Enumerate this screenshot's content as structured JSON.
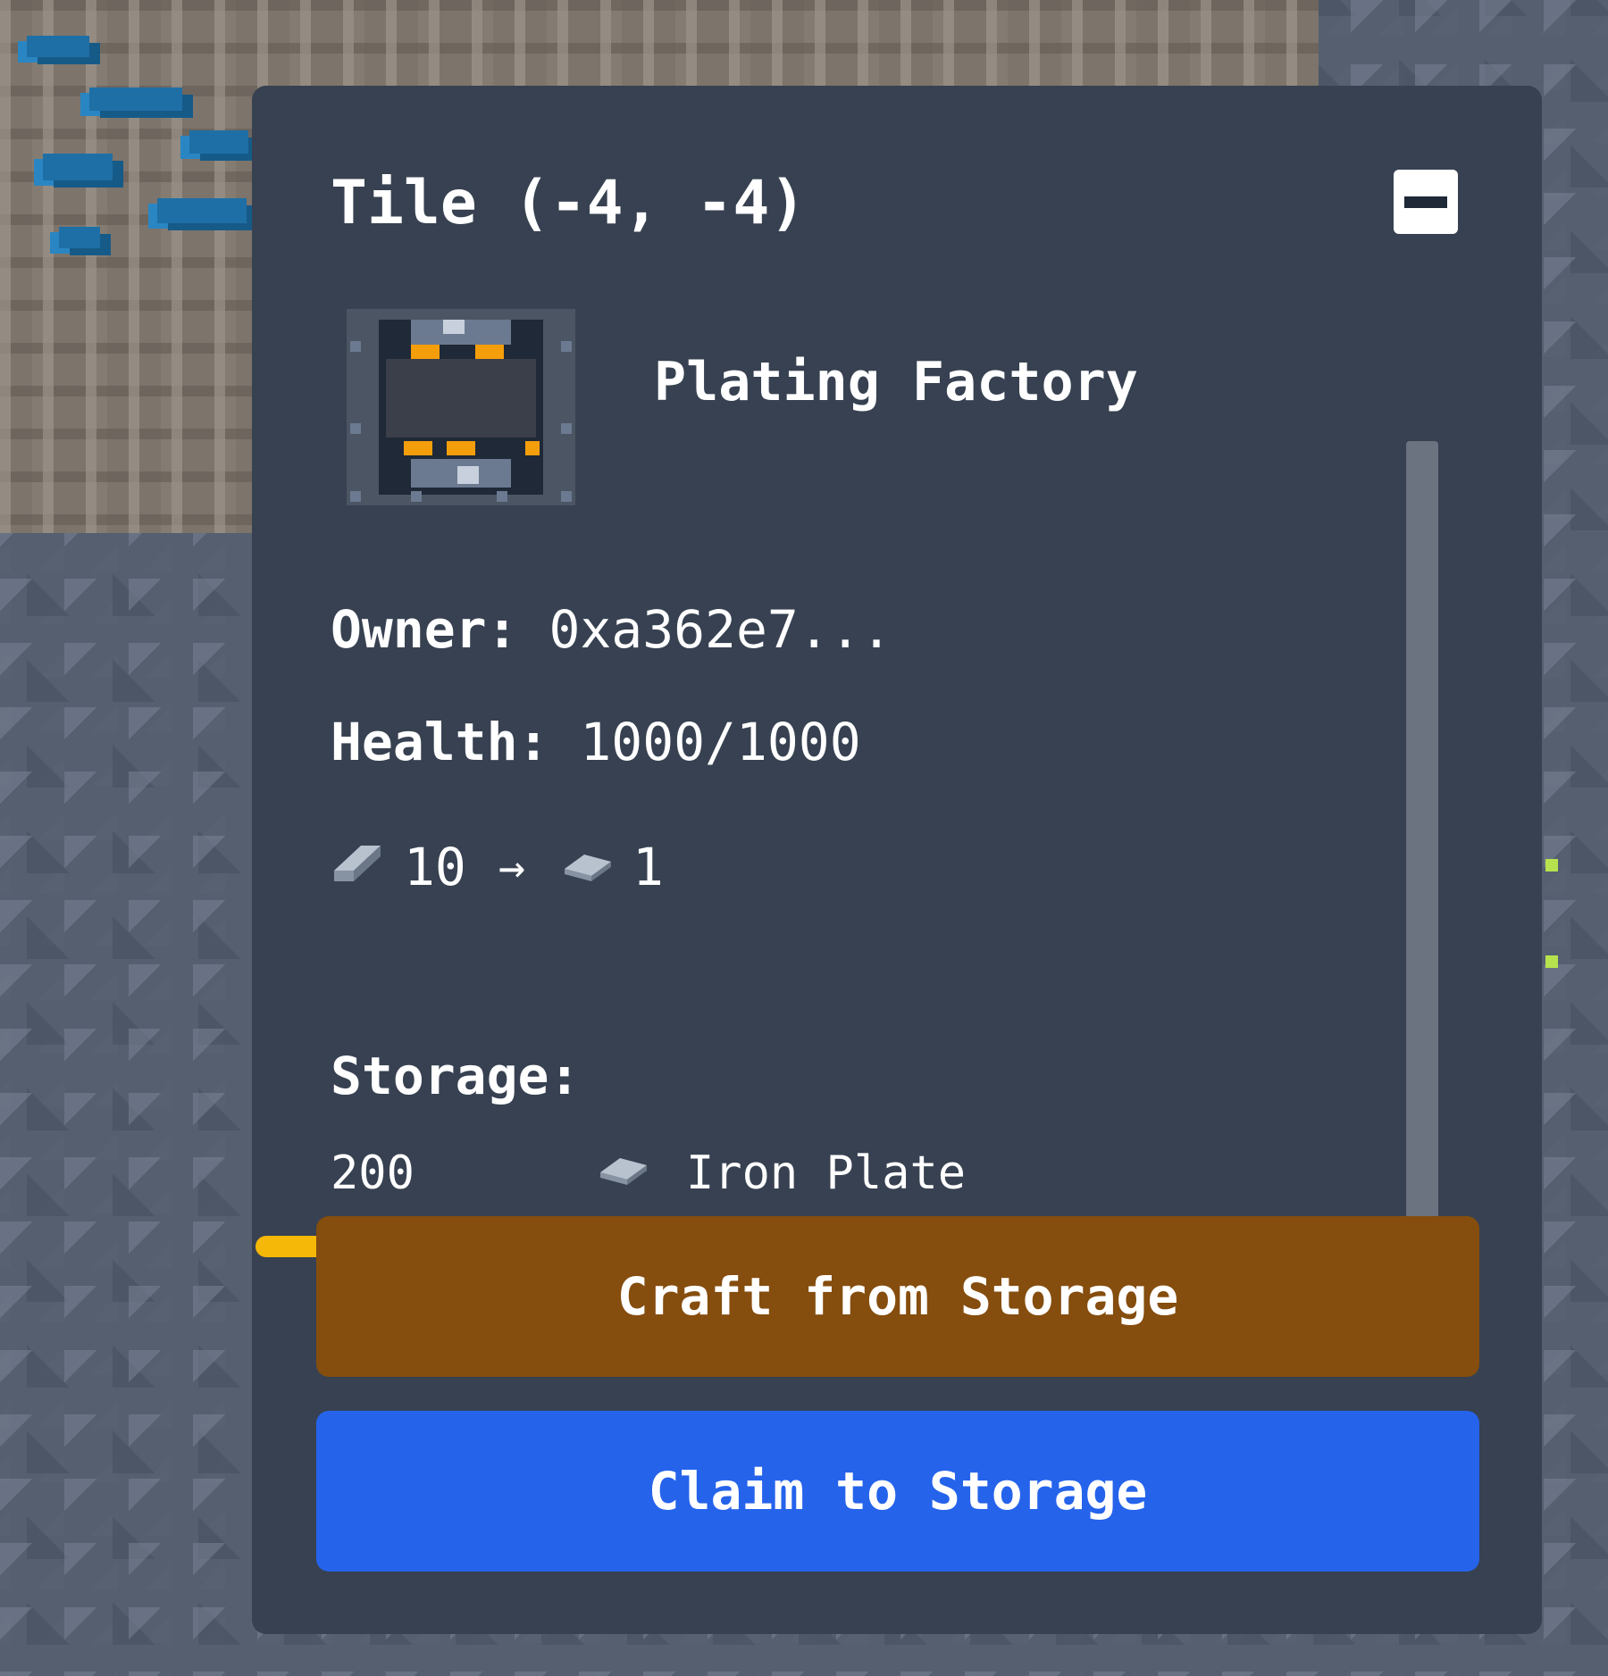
{
  "tile": {
    "title": "Tile (-4, -4)"
  },
  "building": {
    "name": "Plating Factory",
    "icon": "plating-factory-icon"
  },
  "owner": {
    "label": "Owner:",
    "value": "0xa362e7..."
  },
  "health": {
    "label": "Health:",
    "value": "1000/1000"
  },
  "recipe": {
    "input_icon": "iron-ingot-icon",
    "input_amount": "10",
    "arrow": "→",
    "output_icon": "iron-plate-icon",
    "output_amount": "1"
  },
  "storage": {
    "label": "Storage:",
    "items": [
      {
        "quantity": "200",
        "icon": "iron-plate-icon",
        "name": "Iron Plate"
      }
    ],
    "progress_fraction": 0.7
  },
  "buttons": {
    "craft_label": "Craft from Storage",
    "claim_label": "Claim to Storage"
  },
  "colors": {
    "panel_bg": "#374151",
    "craft_button": "#854d0e",
    "claim_button": "#2563eb",
    "progress": "#f5b708",
    "scrollbar": "#6b7280"
  }
}
